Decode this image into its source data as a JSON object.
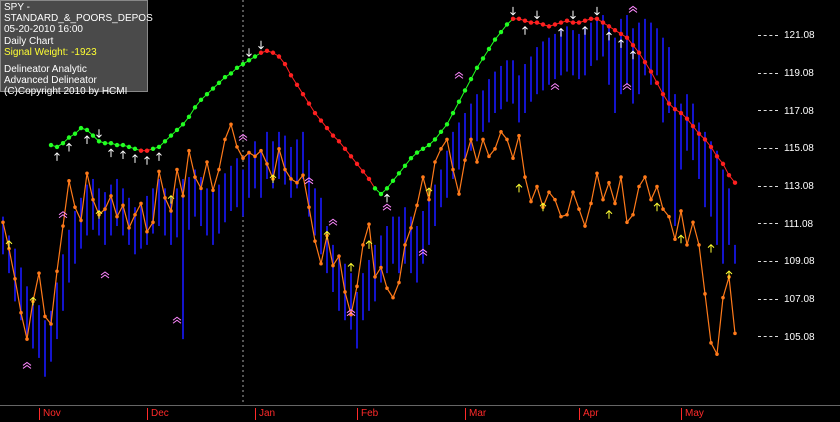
{
  "info": {
    "symbol": "SPY - STANDARD_&_POORS_DEPOS",
    "datetime": "05-20-2010  16:00",
    "period": "Daily Chart",
    "signal_weight": "Signal Weight: -1923",
    "product1": "Delineator Analytic",
    "product2": "Advanced Delineator",
    "copyright": "(C)Copyright 2010 by HCMI"
  },
  "colors": {
    "background": "#000000",
    "price_bar": "#1a1aff",
    "analytic_line": "#ff7a1a",
    "delineator_up": "#22ff22",
    "delineator_down": "#ff2020",
    "month_label": "#ff2a2a",
    "marker_white": "#ffffff",
    "marker_yellow": "#ffff33",
    "marker_pink": "#ff88ff"
  },
  "chart_data": {
    "type": "line",
    "xlabel": "",
    "ylabel": "",
    "months": [
      "Nov",
      "Dec",
      "Jan",
      "Feb",
      "Mar",
      "Apr",
      "May"
    ],
    "month_index": [
      6,
      24,
      42,
      59,
      77,
      96,
      113
    ],
    "y_ticks": [
      "121.08",
      "119.08",
      "117.08",
      "115.08",
      "113.08",
      "111.08",
      "109.08",
      "107.08",
      "105.08"
    ],
    "y_tick_values": [
      121.08,
      119.08,
      117.08,
      115.08,
      113.08,
      111.08,
      109.08,
      107.08,
      105.08
    ],
    "ylim": [
      101.5,
      123.0
    ],
    "n_bars": 123,
    "vertical_marker_index": 40,
    "bars": [
      [
        109.5,
        111.5
      ],
      [
        108.5,
        110.5
      ],
      [
        107.0,
        109.8
      ],
      [
        106.0,
        108.8
      ],
      [
        105.2,
        107.8
      ],
      [
        104.5,
        107.2
      ],
      [
        104.0,
        106.8
      ],
      [
        103.0,
        106.0
      ],
      [
        103.8,
        106.5
      ],
      [
        105.0,
        108.0
      ],
      [
        106.5,
        109.5
      ],
      [
        108.0,
        110.8
      ],
      [
        109.0,
        111.8
      ],
      [
        109.8,
        112.5
      ],
      [
        110.5,
        113.2
      ],
      [
        110.8,
        113.5
      ],
      [
        110.5,
        113.0
      ],
      [
        110.0,
        112.8
      ],
      [
        110.5,
        113.2
      ],
      [
        111.0,
        113.5
      ],
      [
        110.5,
        113.0
      ],
      [
        110.0,
        112.5
      ],
      [
        109.5,
        112.0
      ],
      [
        109.8,
        112.2
      ],
      [
        110.0,
        112.6
      ],
      [
        110.6,
        113.0
      ],
      [
        111.0,
        113.5
      ],
      [
        110.5,
        113.0
      ],
      [
        110.0,
        112.6
      ],
      [
        110.4,
        113.0
      ],
      [
        105.0,
        113.5
      ],
      [
        110.8,
        113.6
      ],
      [
        111.5,
        114.0
      ],
      [
        111.0,
        113.6
      ],
      [
        110.5,
        113.0
      ],
      [
        110.0,
        112.8
      ],
      [
        110.6,
        113.2
      ],
      [
        111.2,
        113.8
      ],
      [
        111.8,
        114.2
      ],
      [
        112.0,
        114.6
      ],
      [
        111.5,
        114.0
      ],
      [
        112.5,
        115.0
      ],
      [
        113.0,
        115.5
      ],
      [
        112.5,
        115.0
      ],
      [
        113.5,
        116.0
      ],
      [
        113.0,
        115.5
      ],
      [
        113.5,
        116.0
      ],
      [
        113.2,
        115.8
      ],
      [
        112.5,
        115.2
      ],
      [
        113.0,
        115.6
      ],
      [
        113.5,
        116.0
      ],
      [
        111.5,
        114.5
      ],
      [
        110.5,
        113.0
      ],
      [
        109.5,
        112.5
      ],
      [
        108.5,
        111.0
      ],
      [
        107.5,
        110.0
      ],
      [
        106.5,
        109.5
      ],
      [
        106.0,
        109.0
      ],
      [
        105.5,
        108.5
      ],
      [
        104.5,
        107.5
      ],
      [
        106.0,
        108.5
      ],
      [
        106.5,
        109.2
      ],
      [
        107.0,
        110.0
      ],
      [
        108.0,
        110.5
      ],
      [
        108.5,
        111.0
      ],
      [
        109.0,
        111.5
      ],
      [
        108.5,
        111.5
      ],
      [
        109.0,
        112.0
      ],
      [
        108.5,
        111.5
      ],
      [
        108.0,
        111.0
      ],
      [
        109.0,
        111.8
      ],
      [
        110.0,
        112.5
      ],
      [
        111.0,
        113.2
      ],
      [
        112.0,
        114.0
      ],
      [
        112.5,
        115.0
      ],
      [
        113.5,
        116.0
      ],
      [
        114.0,
        116.5
      ],
      [
        114.5,
        117.0
      ],
      [
        115.0,
        117.5
      ],
      [
        115.5,
        118.0
      ],
      [
        116.0,
        118.2
      ],
      [
        116.5,
        118.8
      ],
      [
        117.0,
        119.2
      ],
      [
        117.2,
        119.5
      ],
      [
        117.6,
        119.8
      ],
      [
        117.5,
        119.8
      ],
      [
        116.5,
        119.0
      ],
      [
        117.0,
        119.6
      ],
      [
        117.6,
        120.0
      ],
      [
        118.0,
        120.5
      ],
      [
        118.2,
        120.8
      ],
      [
        118.5,
        121.0
      ],
      [
        118.8,
        121.2
      ],
      [
        119.0,
        121.4
      ],
      [
        119.2,
        121.6
      ],
      [
        119.0,
        121.4
      ],
      [
        118.8,
        121.2
      ],
      [
        119.0,
        121.5
      ],
      [
        119.5,
        121.8
      ],
      [
        119.8,
        122.0
      ],
      [
        120.0,
        122.2
      ],
      [
        118.5,
        121.5
      ],
      [
        117.0,
        121.0
      ],
      [
        118.0,
        122.0
      ],
      [
        118.5,
        122.2
      ],
      [
        117.5,
        121.5
      ],
      [
        118.0,
        121.8
      ],
      [
        119.0,
        122.0
      ],
      [
        118.5,
        121.8
      ],
      [
        119.0,
        121.5
      ],
      [
        116.5,
        121.0
      ],
      [
        117.0,
        120.5
      ],
      [
        111.0,
        118.0
      ],
      [
        114.0,
        117.5
      ],
      [
        115.0,
        118.0
      ],
      [
        114.5,
        117.5
      ],
      [
        113.5,
        116.5
      ],
      [
        112.0,
        116.0
      ],
      [
        111.5,
        115.5
      ],
      [
        110.0,
        115.0
      ],
      [
        109.0,
        114.0
      ],
      [
        110.0,
        113.0
      ],
      [
        109.0,
        110.0
      ]
    ],
    "analytic": [
      [
        0,
        111.2
      ],
      [
        1,
        109.8
      ],
      [
        2,
        108.2
      ],
      [
        3,
        106.4
      ],
      [
        4,
        105.0
      ],
      [
        5,
        107.0
      ],
      [
        6,
        108.5
      ],
      [
        7,
        106.2
      ],
      [
        8,
        105.8
      ],
      [
        9,
        108.6
      ],
      [
        10,
        111.0
      ],
      [
        11,
        113.4
      ],
      [
        12,
        112.0
      ],
      [
        13,
        111.3
      ],
      [
        14,
        113.8
      ],
      [
        15,
        112.4
      ],
      [
        16,
        111.6
      ],
      [
        17,
        111.9
      ],
      [
        18,
        112.6
      ],
      [
        19,
        111.5
      ],
      [
        20,
        112.1
      ],
      [
        21,
        110.9
      ],
      [
        22,
        111.6
      ],
      [
        23,
        112.2
      ],
      [
        24,
        110.7
      ],
      [
        25,
        111.2
      ],
      [
        26,
        113.9
      ],
      [
        27,
        112.5
      ],
      [
        28,
        111.8
      ],
      [
        29,
        114.0
      ],
      [
        30,
        112.6
      ],
      [
        31,
        115.0
      ],
      [
        32,
        113.6
      ],
      [
        33,
        113.0
      ],
      [
        34,
        114.4
      ],
      [
        35,
        112.9
      ],
      [
        36,
        114.0
      ],
      [
        37,
        115.6
      ],
      [
        38,
        116.4
      ],
      [
        39,
        115.2
      ],
      [
        40,
        114.6
      ],
      [
        41,
        114.9
      ],
      [
        42,
        114.7
      ],
      [
        43,
        115.0
      ],
      [
        44,
        114.3
      ],
      [
        45,
        113.5
      ],
      [
        46,
        115.1
      ],
      [
        47,
        114.0
      ],
      [
        48,
        113.5
      ],
      [
        49,
        113.3
      ],
      [
        50,
        113.7
      ],
      [
        51,
        112.0
      ],
      [
        52,
        110.2
      ],
      [
        53,
        109.0
      ],
      [
        54,
        110.5
      ],
      [
        55,
        108.9
      ],
      [
        56,
        109.4
      ],
      [
        57,
        107.5
      ],
      [
        58,
        106.3
      ],
      [
        59,
        107.8
      ],
      [
        60,
        110.0
      ],
      [
        61,
        111.1
      ],
      [
        62,
        108.3
      ],
      [
        63,
        108.8
      ],
      [
        64,
        107.7
      ],
      [
        65,
        107.2
      ],
      [
        66,
        108.0
      ],
      [
        67,
        110.0
      ],
      [
        68,
        110.9
      ],
      [
        69,
        112.1
      ],
      [
        70,
        113.6
      ],
      [
        71,
        112.4
      ],
      [
        72,
        114.4
      ],
      [
        73,
        115.1
      ],
      [
        74,
        115.6
      ],
      [
        75,
        114.0
      ],
      [
        76,
        112.7
      ],
      [
        77,
        114.5
      ],
      [
        78,
        115.6
      ],
      [
        79,
        114.4
      ],
      [
        80,
        115.6
      ],
      [
        81,
        114.7
      ],
      [
        82,
        115.1
      ],
      [
        83,
        116.0
      ],
      [
        84,
        115.6
      ],
      [
        85,
        114.6
      ],
      [
        86,
        115.8
      ],
      [
        87,
        113.6
      ],
      [
        88,
        112.3
      ],
      [
        89,
        113.1
      ],
      [
        90,
        112.0
      ],
      [
        91,
        112.8
      ],
      [
        92,
        112.4
      ],
      [
        93,
        111.5
      ],
      [
        94,
        111.6
      ],
      [
        95,
        112.8
      ],
      [
        96,
        111.9
      ],
      [
        97,
        111.0
      ],
      [
        98,
        112.2
      ],
      [
        99,
        113.8
      ],
      [
        100,
        112.4
      ],
      [
        101,
        113.3
      ],
      [
        102,
        112.2
      ],
      [
        103,
        113.6
      ],
      [
        104,
        111.2
      ],
      [
        105,
        111.6
      ],
      [
        106,
        113.1
      ],
      [
        107,
        113.6
      ],
      [
        108,
        112.4
      ],
      [
        109,
        113.1
      ],
      [
        110,
        111.9
      ],
      [
        111,
        111.5
      ],
      [
        112,
        110.3
      ],
      [
        113,
        111.8
      ],
      [
        114,
        110.0
      ],
      [
        115,
        111.2
      ],
      [
        116,
        110.0
      ],
      [
        117,
        107.4
      ],
      [
        118,
        104.8
      ],
      [
        119,
        104.2
      ],
      [
        120,
        107.2
      ],
      [
        121,
        108.3
      ],
      [
        122,
        105.3
      ]
    ],
    "delineator": [
      [
        8,
        115.3
      ],
      [
        9,
        115.2
      ],
      [
        10,
        115.4
      ],
      [
        11,
        115.7
      ],
      [
        12,
        115.9
      ],
      [
        13,
        116.2
      ],
      [
        14,
        116.1
      ],
      [
        15,
        115.8
      ],
      [
        16,
        115.5
      ],
      [
        17,
        115.4
      ],
      [
        18,
        115.4
      ],
      [
        19,
        115.3
      ],
      [
        20,
        115.3
      ],
      [
        21,
        115.2
      ],
      [
        22,
        115.1
      ],
      [
        23,
        115.0
      ],
      [
        24,
        115.0
      ],
      [
        25,
        115.1
      ],
      [
        26,
        115.2
      ],
      [
        27,
        115.5
      ],
      [
        28,
        115.8
      ],
      [
        29,
        116.1
      ],
      [
        30,
        116.4
      ],
      [
        31,
        116.8
      ],
      [
        32,
        117.3
      ],
      [
        33,
        117.7
      ],
      [
        34,
        118.0
      ],
      [
        35,
        118.3
      ],
      [
        36,
        118.6
      ],
      [
        37,
        118.9
      ],
      [
        38,
        119.1
      ],
      [
        39,
        119.4
      ],
      [
        40,
        119.6
      ],
      [
        41,
        119.8
      ],
      [
        42,
        120.0
      ],
      [
        43,
        120.2
      ],
      [
        44,
        120.3
      ],
      [
        45,
        120.2
      ],
      [
        46,
        120.0
      ],
      [
        47,
        119.6
      ],
      [
        48,
        119.0
      ],
      [
        49,
        118.5
      ],
      [
        50,
        118.0
      ],
      [
        51,
        117.5
      ],
      [
        52,
        117.0
      ],
      [
        53,
        116.6
      ],
      [
        54,
        116.2
      ],
      [
        55,
        115.8
      ],
      [
        56,
        115.5
      ],
      [
        57,
        115.1
      ],
      [
        58,
        114.7
      ],
      [
        59,
        114.3
      ],
      [
        60,
        113.9
      ],
      [
        61,
        113.5
      ],
      [
        62,
        113.0
      ],
      [
        63,
        112.7
      ],
      [
        64,
        113.0
      ],
      [
        65,
        113.4
      ],
      [
        66,
        113.8
      ],
      [
        67,
        114.2
      ],
      [
        68,
        114.6
      ],
      [
        69,
        114.9
      ],
      [
        70,
        115.1
      ],
      [
        71,
        115.3
      ],
      [
        72,
        115.6
      ],
      [
        73,
        116.0
      ],
      [
        74,
        116.4
      ],
      [
        75,
        117.0
      ],
      [
        76,
        117.6
      ],
      [
        77,
        118.2
      ],
      [
        78,
        118.8
      ],
      [
        79,
        119.4
      ],
      [
        80,
        119.9
      ],
      [
        81,
        120.4
      ],
      [
        82,
        120.9
      ],
      [
        83,
        121.3
      ],
      [
        84,
        121.7
      ],
      [
        85,
        122.0
      ],
      [
        86,
        122.0
      ],
      [
        87,
        121.9
      ],
      [
        88,
        121.8
      ],
      [
        89,
        121.8
      ],
      [
        90,
        121.7
      ],
      [
        91,
        121.6
      ],
      [
        92,
        121.7
      ],
      [
        93,
        121.8
      ],
      [
        94,
        121.9
      ],
      [
        95,
        121.8
      ],
      [
        96,
        121.8
      ],
      [
        97,
        121.9
      ],
      [
        98,
        122.0
      ],
      [
        99,
        122.0
      ],
      [
        100,
        121.8
      ],
      [
        101,
        121.6
      ],
      [
        102,
        121.4
      ],
      [
        103,
        121.2
      ],
      [
        104,
        121.0
      ],
      [
        105,
        120.6
      ],
      [
        106,
        120.2
      ],
      [
        107,
        119.7
      ],
      [
        108,
        119.2
      ],
      [
        109,
        118.6
      ],
      [
        110,
        118.0
      ],
      [
        111,
        117.5
      ],
      [
        112,
        117.2
      ],
      [
        113,
        117.0
      ],
      [
        114,
        116.7
      ],
      [
        115,
        116.3
      ],
      [
        116,
        115.9
      ],
      [
        117,
        115.6
      ],
      [
        118,
        115.2
      ],
      [
        119,
        114.7
      ],
      [
        120,
        114.3
      ],
      [
        121,
        113.7
      ],
      [
        122,
        113.3
      ]
    ],
    "delineator_up_segments": [
      [
        8,
        22
      ],
      [
        25,
        42
      ],
      [
        62,
        84
      ]
    ],
    "white_arrows": [
      [
        9,
        "up"
      ],
      [
        11,
        "up"
      ],
      [
        14,
        "up"
      ],
      [
        16,
        "down"
      ],
      [
        18,
        "up"
      ],
      [
        20,
        "up"
      ],
      [
        22,
        "up"
      ],
      [
        24,
        "up"
      ],
      [
        26,
        "up"
      ],
      [
        41,
        "down"
      ],
      [
        43,
        "down"
      ],
      [
        64,
        "up"
      ],
      [
        85,
        "down"
      ],
      [
        87,
        "up"
      ],
      [
        89,
        "down"
      ],
      [
        93,
        "up"
      ],
      [
        95,
        "down"
      ],
      [
        97,
        "up"
      ],
      [
        99,
        "down"
      ],
      [
        101,
        "up"
      ],
      [
        103,
        "up"
      ],
      [
        105,
        "up"
      ]
    ],
    "yellow_markers": [
      [
        1,
        110.0
      ],
      [
        5,
        107.0
      ],
      [
        16,
        111.6
      ],
      [
        28,
        112.4
      ],
      [
        45,
        113.5
      ],
      [
        54,
        110.5
      ],
      [
        58,
        108.8
      ],
      [
        61,
        110.0
      ],
      [
        71,
        112.8
      ],
      [
        86,
        113.0
      ],
      [
        90,
        112.0
      ],
      [
        101,
        111.6
      ],
      [
        109,
        112.0
      ],
      [
        113,
        110.3
      ],
      [
        118,
        109.8
      ],
      [
        121,
        108.4
      ]
    ],
    "pink_markers": [
      [
        4,
        103.6
      ],
      [
        10,
        111.6
      ],
      [
        17,
        108.4
      ],
      [
        29,
        106.0
      ],
      [
        40,
        115.7
      ],
      [
        51,
        113.4
      ],
      [
        55,
        111.2
      ],
      [
        58,
        106.4
      ],
      [
        64,
        112.0
      ],
      [
        70,
        109.6
      ],
      [
        76,
        119.0
      ],
      [
        92,
        118.4
      ],
      [
        104,
        118.4
      ],
      [
        105,
        122.5
      ]
    ]
  }
}
